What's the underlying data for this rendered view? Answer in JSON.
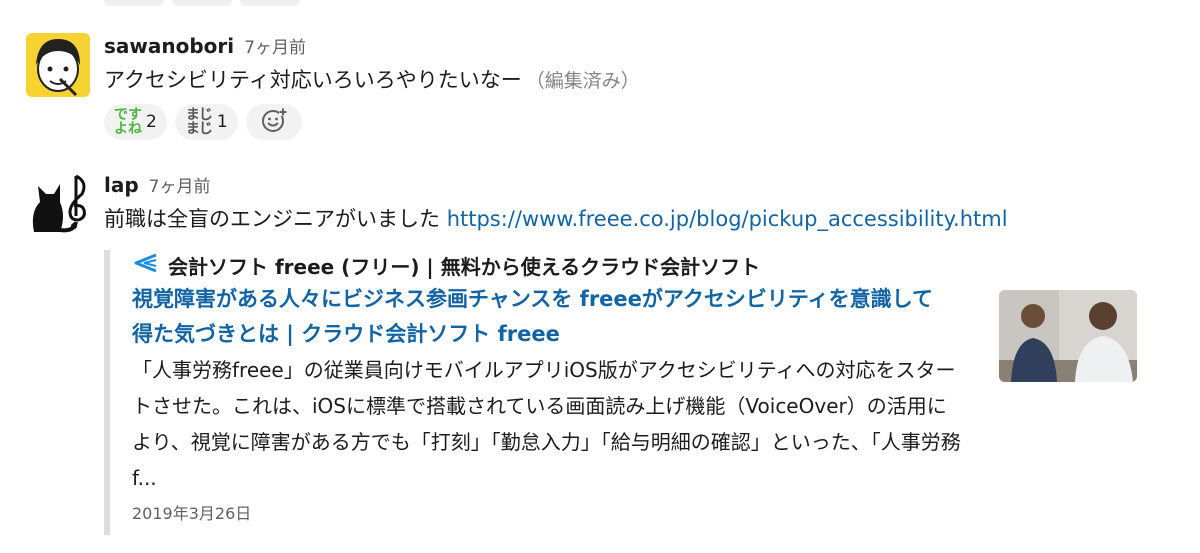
{
  "messages": [
    {
      "username": "sawanobori",
      "time": "7ヶ月前",
      "text": "アクセシビリティ対応いろいろやりたいなー",
      "edited": "（編集済み）",
      "reactions": [
        {
          "emoji_text": "です\nよね",
          "emoji_name": "desu-yone-emoji",
          "count": "2"
        },
        {
          "emoji_text": "まじ\nまじ",
          "emoji_name": "majimaji-emoji",
          "count": "1"
        }
      ]
    },
    {
      "username": "lap",
      "time": "7ヶ月前",
      "text": "前職は全盲のエンジニアがいました",
      "link": "https://www.freee.co.jp/blog/pickup_accessibility.html",
      "unfurl": {
        "site_name": "会計ソフト freee (フリー) | 無料から使えるクラウド会計ソフト",
        "title": "視覚障害がある人々にビジネス参画チャンスを freeeがアクセシビリティを意識して得た気づきとは | クラウド会計ソフト freee",
        "description": "「人事労務freee」の従業員向けモバイルアプリiOS版がアクセシビリティへの対応をスタートさせた。これは、iOSに標準で搭載されている画面読み上げ機能（VoiceOver）の活用により、視覚に障害がある方でも「打刻」「勤怠入力」「給与明細の確認」といった、「人事労務f...",
        "date": "2019年3月26日"
      }
    }
  ],
  "colors": {
    "link": "#1264a3",
    "border": "#dddddd",
    "reaction_bg": "#f2f2f2",
    "avatar_yellow": "#f7d332"
  }
}
